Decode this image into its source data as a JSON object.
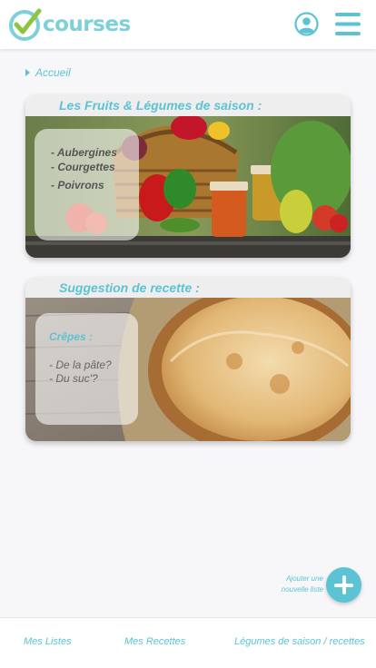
{
  "header": {
    "logo_text": "courses",
    "profile_icon": "user-circle-icon",
    "menu_icon": "hamburger-menu-icon"
  },
  "breadcrumb": {
    "label": "Accueil"
  },
  "season_card": {
    "title": "Les Fruits & Légumes de saison :",
    "items": [
      "- Aubergines",
      "- Courgettes",
      "- Poivrons"
    ]
  },
  "recipe_card": {
    "title": "Suggestion de recette :",
    "recipe_name": "Crêpes :",
    "lines": [
      "- De la pâte?",
      "- Du suc'?"
    ]
  },
  "add_list": {
    "label_line1": "Ajouter une",
    "label_line2": "nouvelle liste"
  },
  "bottom_nav": {
    "items": [
      "Mes Listes",
      "Mes Recettes",
      "Légumes de saison / recettes"
    ]
  },
  "colors": {
    "accent": "#5bc3d4",
    "logo_green": "#8cc63f",
    "background": "#f7f7f9"
  }
}
